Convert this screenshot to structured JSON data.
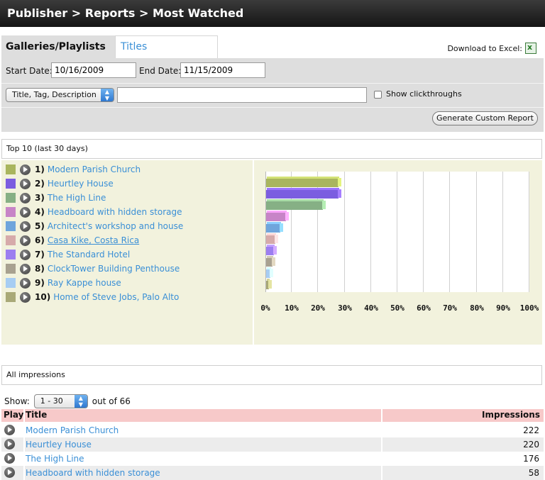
{
  "header": {
    "title": "Publisher > Reports > Most Watched"
  },
  "tabs": {
    "active": "Galleries/Playlists",
    "other": "Titles"
  },
  "download": {
    "label": "Download to Excel:",
    "icon": "excel-icon"
  },
  "filters": {
    "start_label": "Start Date:",
    "start_value": "10/16/2009",
    "end_label": "End Date:",
    "end_value": "11/15/2009",
    "search_field_select": "Title, Tag, Description",
    "search_value": "",
    "show_clickthroughs_label": "Show clickthroughs",
    "generate_button": "Generate Custom Report"
  },
  "top10": {
    "heading": "Top 10 (last 30 days)",
    "items": [
      {
        "rank": "1)",
        "title": "Modern Parish Church",
        "color": "#a9b55e",
        "underline": false
      },
      {
        "rank": "2)",
        "title": "Heurtley House",
        "color": "#7b5de0",
        "underline": false
      },
      {
        "rank": "3)",
        "title": "The High Line",
        "color": "#86b085",
        "underline": false
      },
      {
        "rank": "4)",
        "title": "Headboard with hidden storage",
        "color": "#c784c7",
        "underline": false
      },
      {
        "rank": "5)",
        "title": "Architect's workshop and house",
        "color": "#6fa5dc",
        "underline": false
      },
      {
        "rank": "6)",
        "title": "Casa Kike, Costa Rica",
        "color": "#d6aaaa",
        "underline": true
      },
      {
        "rank": "7)",
        "title": "The Standard Hotel",
        "color": "#9c7ef0",
        "underline": false
      },
      {
        "rank": "8)",
        "title": "ClockTower Building Penthouse",
        "color": "#a8a190",
        "underline": false
      },
      {
        "rank": "9)",
        "title": "Ray Kappe house",
        "color": "#a7cdf3",
        "underline": false
      },
      {
        "rank": "10)",
        "title": "Home of Steve Jobs, Palo Alto",
        "color": "#a9a978",
        "underline": false
      }
    ]
  },
  "chart_data": {
    "type": "bar",
    "orientation": "horizontal",
    "categories": [
      "Modern Parish Church",
      "Heurtley House",
      "The High Line",
      "Headboard with hidden storage",
      "Architect's workshop and house",
      "Casa Kike, Costa Rica",
      "The Standard Hotel",
      "ClockTower Building Penthouse",
      "Ray Kappe house",
      "Home of Steve Jobs, Palo Alto"
    ],
    "values": [
      27.5,
      27.5,
      21.5,
      7.5,
      5.5,
      3.5,
      3.0,
      2.5,
      1.5,
      1.0
    ],
    "colors": [
      "#a9b55e",
      "#7b5de0",
      "#86b085",
      "#c784c7",
      "#6fa5dc",
      "#d6aaaa",
      "#9c7ef0",
      "#a8a190",
      "#a7cdf3",
      "#a9a978"
    ],
    "xlim": [
      0,
      100
    ],
    "x_ticks": [
      "0%",
      "10%",
      "20%",
      "30%",
      "40%",
      "50%",
      "60%",
      "70%",
      "80%",
      "90%",
      "100%"
    ],
    "grid": true
  },
  "impressions": {
    "heading": "All impressions",
    "show_label": "Show:",
    "range_select": "1 - 30",
    "out_of": "out of 66",
    "columns": {
      "play": "Play",
      "title": "Title",
      "impressions": "Impressions"
    },
    "rows": [
      {
        "title": "Modern Parish Church",
        "value": "222"
      },
      {
        "title": "Heurtley House",
        "value": "220"
      },
      {
        "title": "The High Line",
        "value": "176"
      },
      {
        "title": "Headboard with hidden storage",
        "value": "58"
      }
    ]
  }
}
